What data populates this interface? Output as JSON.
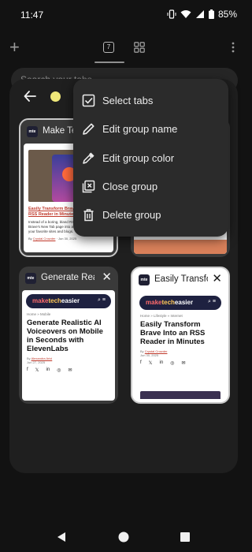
{
  "status_bar": {
    "time": "11:47",
    "battery_pct": "85%"
  },
  "toolbar": {
    "tab_count": "7",
    "new_tab_icon": "plus-icon",
    "grid_icon": "grid-icon",
    "more_icon": "kebab-icon"
  },
  "search": {
    "placeholder": "Search your tabs"
  },
  "group": {
    "color": "#f0e87a"
  },
  "tabs": [
    {
      "title": "Make Tech Easier",
      "favicon": "mte",
      "headline": "Easily Transform Brave Into an RSS Reader in Minutes",
      "summary": "Instead of a boring, bland RSS reader, transform the Brave's New Tab page into a personalized feed of your favorite sites and blogs.",
      "byline_prefix": "By",
      "author": "Crystal Crowder",
      "date": "Jun 30, 2025"
    },
    {
      "title": "",
      "favicon": ""
    },
    {
      "title": "Generate Realistic AI Voiceovers",
      "favicon": "mte",
      "close": "✕",
      "site_name_1": "make",
      "site_name_2": "tech",
      "site_name_3": "easier",
      "crumb": "Home » Mobile",
      "headline": "Generate Realistic AI Voiceovers on Mobile in Seconds with ElevenLabs",
      "byline_prefix": "By",
      "author": "Alexandra Arici",
      "date": "Jun 27, 2025"
    },
    {
      "title": "Easily Transform Brave",
      "favicon": "mte",
      "close": "✕",
      "site_name_1": "make",
      "site_name_2": "tech",
      "site_name_3": "easier",
      "crumb": "Home » Lifestyle » Internet",
      "headline": "Easily Transform Brave Into an RSS Reader in Minutes",
      "byline_prefix": "By",
      "author": "Crystal Crowder",
      "date": "Jun 30, 2025"
    }
  ],
  "menu": {
    "items": [
      {
        "label": "Select tabs",
        "icon": "checkbox-icon"
      },
      {
        "label": "Edit group name",
        "icon": "pencil-icon"
      },
      {
        "label": "Edit group color",
        "icon": "eyedropper-icon"
      },
      {
        "label": "Close group",
        "icon": "close-box-icon"
      },
      {
        "label": "Delete group",
        "icon": "trash-icon"
      }
    ]
  },
  "nav": {
    "back_icon": "back-triangle-icon",
    "home_icon": "home-circle-icon",
    "recents_icon": "recents-square-icon"
  }
}
